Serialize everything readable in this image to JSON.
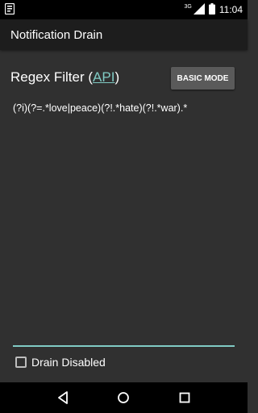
{
  "status_bar": {
    "network_type": "3G",
    "time": "11:04",
    "icons": [
      "notification-icon",
      "signal-icon",
      "battery-icon"
    ]
  },
  "app_bar": {
    "title": "Notification Drain"
  },
  "filter": {
    "label_prefix": "Regex Filter (",
    "link_text": "API",
    "label_suffix": ")",
    "mode_button_label": "BASIC MODE",
    "regex_value": "(?i)(?=.*love|peace)(?!.*hate)(?!.*war).*"
  },
  "drain_toggle": {
    "label": "Drain Disabled",
    "checked": false
  },
  "nav": {
    "icons": [
      "back-icon",
      "home-icon",
      "recents-icon"
    ]
  },
  "colors": {
    "accent": "#80cbc4",
    "background": "#303030",
    "app_bar": "#1d1d1d",
    "button": "#5a5a5a"
  }
}
